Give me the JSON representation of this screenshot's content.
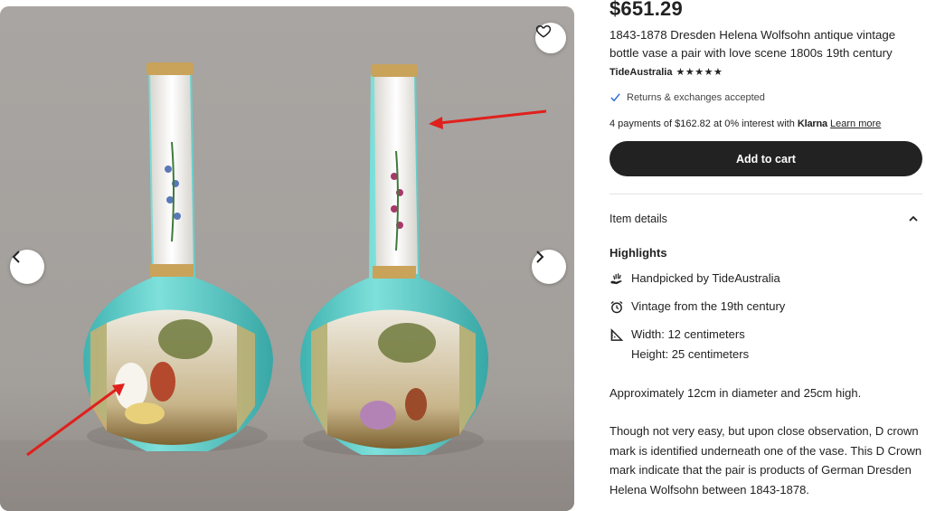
{
  "listing": {
    "price": "$651.29",
    "title": "1843-1878 Dresden Helena Wolfsohn antique vintage bottle vase a pair with love scene 1800s 19th century",
    "shop_name": "TideAustralia",
    "rating_stars": "★★★★★",
    "returns_text": "Returns & exchanges accepted",
    "klarna_prefix": "4 payments of $162.82 at 0% interest with",
    "klarna_brand": "Klarna",
    "klarna_link": "Learn more",
    "add_to_cart": "Add to cart"
  },
  "details": {
    "section_label": "Item details",
    "highlights_label": "Highlights",
    "handpicked_prefix": "Handpicked by",
    "handpicked_shop": "TideAustralia",
    "vintage": "Vintage from the 19th century",
    "width": "Width: 12 centimeters",
    "height": "Height: 25 centimeters",
    "description_1": "Approximately 12cm in diameter and 25cm high.",
    "description_2": "Though not very easy, but upon close observation, D crown mark is identified underneath one of the vase. This D Crown mark indicate that the pair is products of German Dresden Helena Wolfsohn between 1843-1878."
  },
  "icons": {
    "favorite": "heart-icon",
    "previous": "chevron-left-icon",
    "next": "chevron-right-icon",
    "check": "checkmark-icon",
    "collapse": "chevron-up-icon",
    "handpicked": "hand-icon",
    "vintage": "alarm-clock-icon",
    "dimensions": "ruler-triangle-icon"
  },
  "colors": {
    "primary_button": "#222222",
    "check_blue": "#2f6fd6",
    "annotation_arrow": "#e0201c",
    "vase_turquoise": "#5fc9c6",
    "photo_background": "#a5a19d"
  }
}
